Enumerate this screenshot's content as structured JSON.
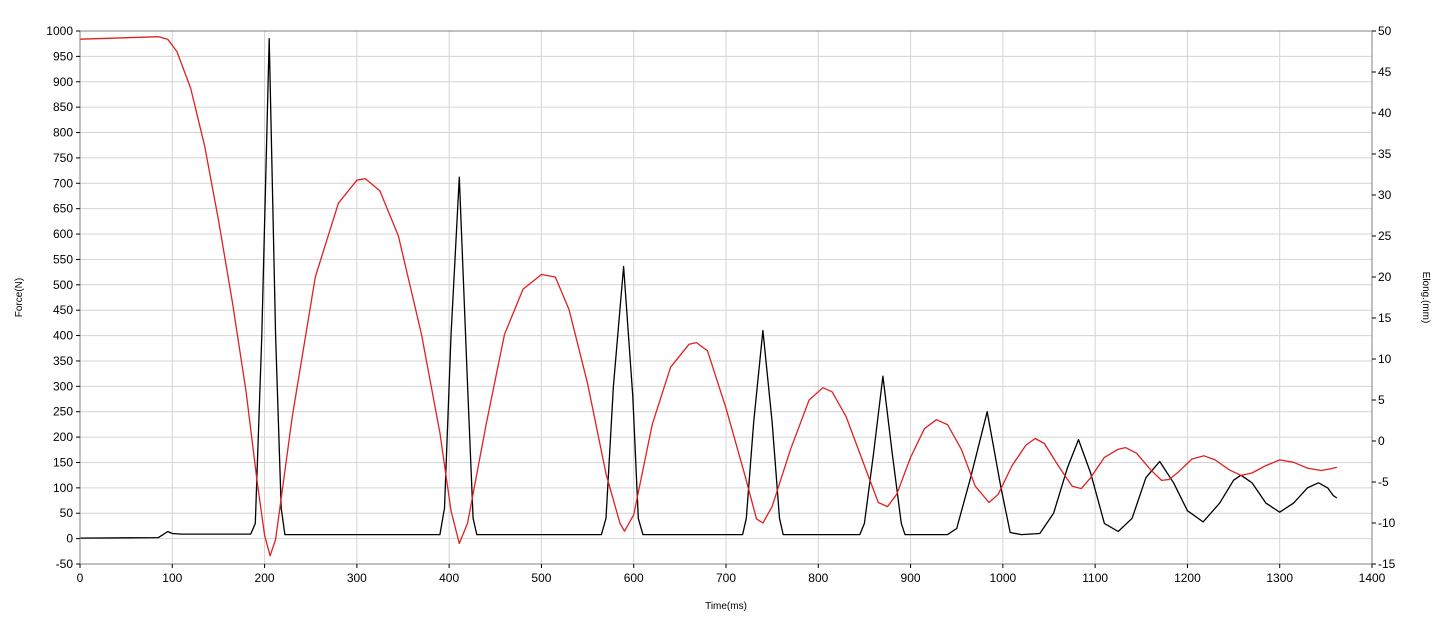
{
  "chart_data": {
    "type": "line",
    "title": "",
    "xlabel": "Time(ms)",
    "ylabel": "Force(N)",
    "y2label": "Elong.(mm)",
    "xlim": [
      0,
      1400
    ],
    "ylim": [
      -50,
      1000
    ],
    "y2lim": [
      -15,
      50
    ],
    "xticks": [
      0,
      100,
      200,
      300,
      400,
      500,
      600,
      700,
      800,
      900,
      1000,
      1100,
      1200,
      1300,
      1400
    ],
    "yticks": [
      -50,
      0,
      50,
      100,
      150,
      200,
      250,
      300,
      350,
      400,
      450,
      500,
      550,
      600,
      650,
      700,
      750,
      800,
      850,
      900,
      950,
      1000
    ],
    "y2ticks": [
      -15,
      -10,
      -5,
      0,
      5,
      10,
      15,
      20,
      25,
      30,
      35,
      40,
      45,
      50
    ],
    "grid": true,
    "series": [
      {
        "axis": "left",
        "color": "#000000",
        "points": [
          [
            0,
            1
          ],
          [
            85,
            2
          ],
          [
            90,
            8
          ],
          [
            95,
            14
          ],
          [
            100,
            10
          ],
          [
            110,
            9
          ],
          [
            150,
            9
          ],
          [
            185,
            9
          ],
          [
            190,
            30
          ],
          [
            197,
            400
          ],
          [
            205,
            985
          ],
          [
            212,
            400
          ],
          [
            218,
            60
          ],
          [
            222,
            8
          ],
          [
            300,
            8
          ],
          [
            390,
            8
          ],
          [
            395,
            60
          ],
          [
            402,
            400
          ],
          [
            411,
            712
          ],
          [
            420,
            300
          ],
          [
            426,
            40
          ],
          [
            430,
            8
          ],
          [
            500,
            8
          ],
          [
            565,
            8
          ],
          [
            570,
            40
          ],
          [
            578,
            300
          ],
          [
            589,
            536
          ],
          [
            599,
            280
          ],
          [
            605,
            40
          ],
          [
            610,
            8
          ],
          [
            700,
            8
          ],
          [
            718,
            8
          ],
          [
            722,
            40
          ],
          [
            730,
            230
          ],
          [
            740,
            410
          ],
          [
            750,
            230
          ],
          [
            758,
            40
          ],
          [
            762,
            8
          ],
          [
            800,
            8
          ],
          [
            845,
            8
          ],
          [
            850,
            30
          ],
          [
            860,
            170
          ],
          [
            870,
            320
          ],
          [
            880,
            170
          ],
          [
            890,
            30
          ],
          [
            894,
            8
          ],
          [
            940,
            8
          ],
          [
            950,
            20
          ],
          [
            965,
            120
          ],
          [
            983,
            250
          ],
          [
            998,
            100
          ],
          [
            1008,
            12
          ],
          [
            1020,
            8
          ],
          [
            1040,
            10
          ],
          [
            1055,
            50
          ],
          [
            1070,
            140
          ],
          [
            1082,
            195
          ],
          [
            1095,
            130
          ],
          [
            1110,
            30
          ],
          [
            1125,
            14
          ],
          [
            1140,
            40
          ],
          [
            1155,
            120
          ],
          [
            1170,
            152
          ],
          [
            1185,
            110
          ],
          [
            1200,
            55
          ],
          [
            1217,
            33
          ],
          [
            1235,
            70
          ],
          [
            1250,
            115
          ],
          [
            1258,
            125
          ],
          [
            1270,
            110
          ],
          [
            1285,
            70
          ],
          [
            1300,
            52
          ],
          [
            1315,
            70
          ],
          [
            1330,
            100
          ],
          [
            1342,
            110
          ],
          [
            1352,
            100
          ],
          [
            1358,
            85
          ],
          [
            1362,
            80
          ]
        ]
      },
      {
        "axis": "right",
        "color": "#e02020",
        "points": [
          [
            0,
            49
          ],
          [
            85,
            49.3
          ],
          [
            95,
            49
          ],
          [
            105,
            47.5
          ],
          [
            120,
            43
          ],
          [
            135,
            36
          ],
          [
            150,
            27
          ],
          [
            165,
            17
          ],
          [
            180,
            6
          ],
          [
            192,
            -5
          ],
          [
            200,
            -11.5
          ],
          [
            206,
            -14
          ],
          [
            212,
            -12
          ],
          [
            230,
            3
          ],
          [
            255,
            20
          ],
          [
            280,
            29
          ],
          [
            300,
            31.8
          ],
          [
            309,
            32
          ],
          [
            325,
            30.5
          ],
          [
            345,
            25
          ],
          [
            370,
            13
          ],
          [
            390,
            1
          ],
          [
            402,
            -8.5
          ],
          [
            411,
            -12.5
          ],
          [
            420,
            -10
          ],
          [
            440,
            2
          ],
          [
            460,
            13
          ],
          [
            480,
            18.5
          ],
          [
            500,
            20.3
          ],
          [
            515,
            20
          ],
          [
            530,
            16
          ],
          [
            550,
            7
          ],
          [
            570,
            -4
          ],
          [
            585,
            -10
          ],
          [
            590,
            -11
          ],
          [
            600,
            -9
          ],
          [
            620,
            2
          ],
          [
            640,
            9
          ],
          [
            660,
            11.8
          ],
          [
            668,
            12
          ],
          [
            680,
            11
          ],
          [
            700,
            4
          ],
          [
            720,
            -4
          ],
          [
            733,
            -9.5
          ],
          [
            740,
            -10
          ],
          [
            750,
            -8
          ],
          [
            770,
            -1
          ],
          [
            790,
            5
          ],
          [
            805,
            6.5
          ],
          [
            815,
            6
          ],
          [
            830,
            3
          ],
          [
            850,
            -3
          ],
          [
            865,
            -7.5
          ],
          [
            875,
            -8
          ],
          [
            885,
            -6.5
          ],
          [
            900,
            -2
          ],
          [
            915,
            1.5
          ],
          [
            928,
            2.6
          ],
          [
            940,
            2
          ],
          [
            955,
            -1
          ],
          [
            970,
            -5.5
          ],
          [
            985,
            -7.5
          ],
          [
            995,
            -6.5
          ],
          [
            1010,
            -3
          ],
          [
            1025,
            -0.5
          ],
          [
            1035,
            0.3
          ],
          [
            1045,
            -0.3
          ],
          [
            1060,
            -3
          ],
          [
            1075,
            -5.5
          ],
          [
            1085,
            -5.8
          ],
          [
            1095,
            -4.5
          ],
          [
            1110,
            -2
          ],
          [
            1125,
            -1
          ],
          [
            1133,
            -0.8
          ],
          [
            1145,
            -1.5
          ],
          [
            1160,
            -3.5
          ],
          [
            1172,
            -4.8
          ],
          [
            1180,
            -4.7
          ],
          [
            1190,
            -3.8
          ],
          [
            1205,
            -2.2
          ],
          [
            1218,
            -1.8
          ],
          [
            1230,
            -2.3
          ],
          [
            1245,
            -3.5
          ],
          [
            1258,
            -4.2
          ],
          [
            1270,
            -3.9
          ],
          [
            1285,
            -3
          ],
          [
            1300,
            -2.3
          ],
          [
            1315,
            -2.6
          ],
          [
            1330,
            -3.3
          ],
          [
            1345,
            -3.6
          ],
          [
            1355,
            -3.4
          ],
          [
            1362,
            -3.2
          ]
        ]
      }
    ]
  }
}
